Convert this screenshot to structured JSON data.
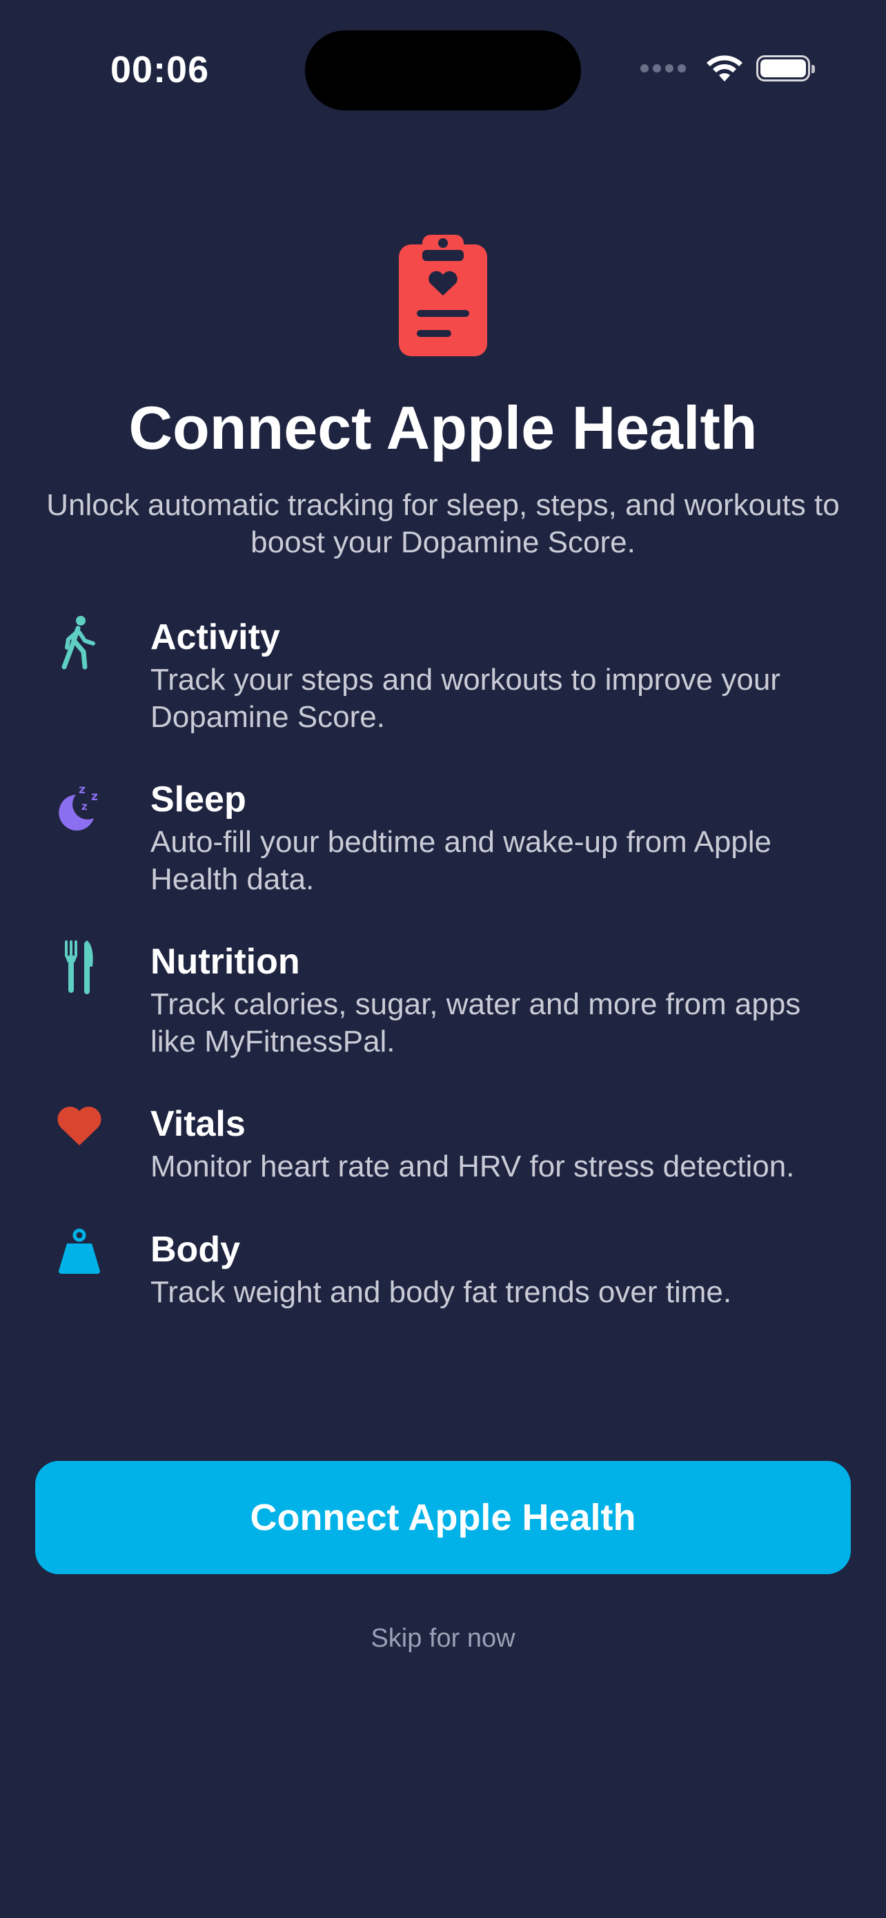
{
  "status_bar": {
    "time": "00:06"
  },
  "header": {
    "icon": "clipboard-heart-icon",
    "title": "Connect Apple Health",
    "subtitle": "Unlock automatic tracking for sleep, steps, and workouts to boost your Dopamine Score."
  },
  "features": [
    {
      "icon": "walking-figure-icon",
      "color": "#5ecfc2",
      "title": "Activity",
      "description": "Track your steps and workouts to improve your Dopamine Score."
    },
    {
      "icon": "moon-zzz-icon",
      "color": "#8b6ff0",
      "title": "Sleep",
      "description": "Auto-fill your bedtime and wake-up from Apple Health data."
    },
    {
      "icon": "fork-knife-icon",
      "color": "#5ecfc2",
      "title": "Nutrition",
      "description": "Track calories, sugar, water and more from apps like MyFitnessPal."
    },
    {
      "icon": "heart-icon",
      "color": "#d9452f",
      "title": "Vitals",
      "description": "Monitor heart rate and HRV for stress detection."
    },
    {
      "icon": "scale-weight-icon",
      "color": "#00b2e8",
      "title": "Body",
      "description": "Track weight and body fat trends over time."
    }
  ],
  "actions": {
    "connect_label": "Connect Apple Health",
    "skip_label": "Skip for now"
  },
  "colors": {
    "background": "#1f2440",
    "accent": "#00b2e8",
    "hero_icon": "#f44a4a"
  }
}
